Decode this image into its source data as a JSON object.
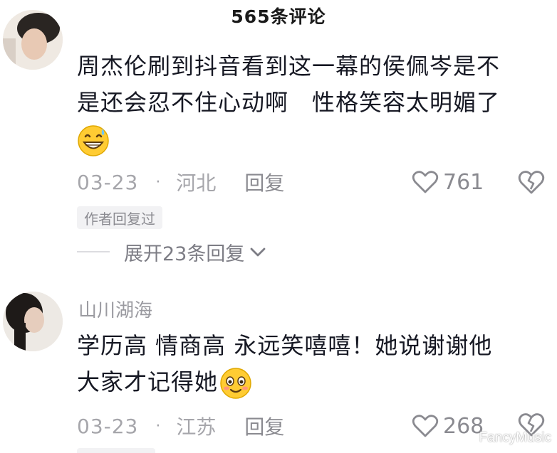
{
  "header": {
    "title": "565条评论"
  },
  "comments": [
    {
      "username": "",
      "text_lines": [
        "周杰伦刷到抖音看到这一幕的侯佩岑是不",
        "是还会忍不住心动啊　性格笑容太明媚了"
      ],
      "emoji_icon": "grinning-sweat-emoji-icon",
      "date": "03-23",
      "separator": "·",
      "location": "河北",
      "reply_label": "回复",
      "likes": "761",
      "badge": "作者回复过",
      "expand_label": "展开23条回复"
    },
    {
      "username": "山川湖海",
      "text_lines": [
        "学历高 情商高 永远笑嘻嘻！她说谢谢他",
        "大家才记得她"
      ],
      "emoji_icon": "smiling-blush-emoji-icon",
      "date": "03-23",
      "separator": "·",
      "location": "江苏",
      "reply_label": "回复",
      "likes": "268"
    }
  ],
  "watermark": "FancyMusic",
  "colors": {
    "text": "#161823",
    "meta": "#a6a6ab",
    "badge_bg": "#f2f2f4"
  }
}
